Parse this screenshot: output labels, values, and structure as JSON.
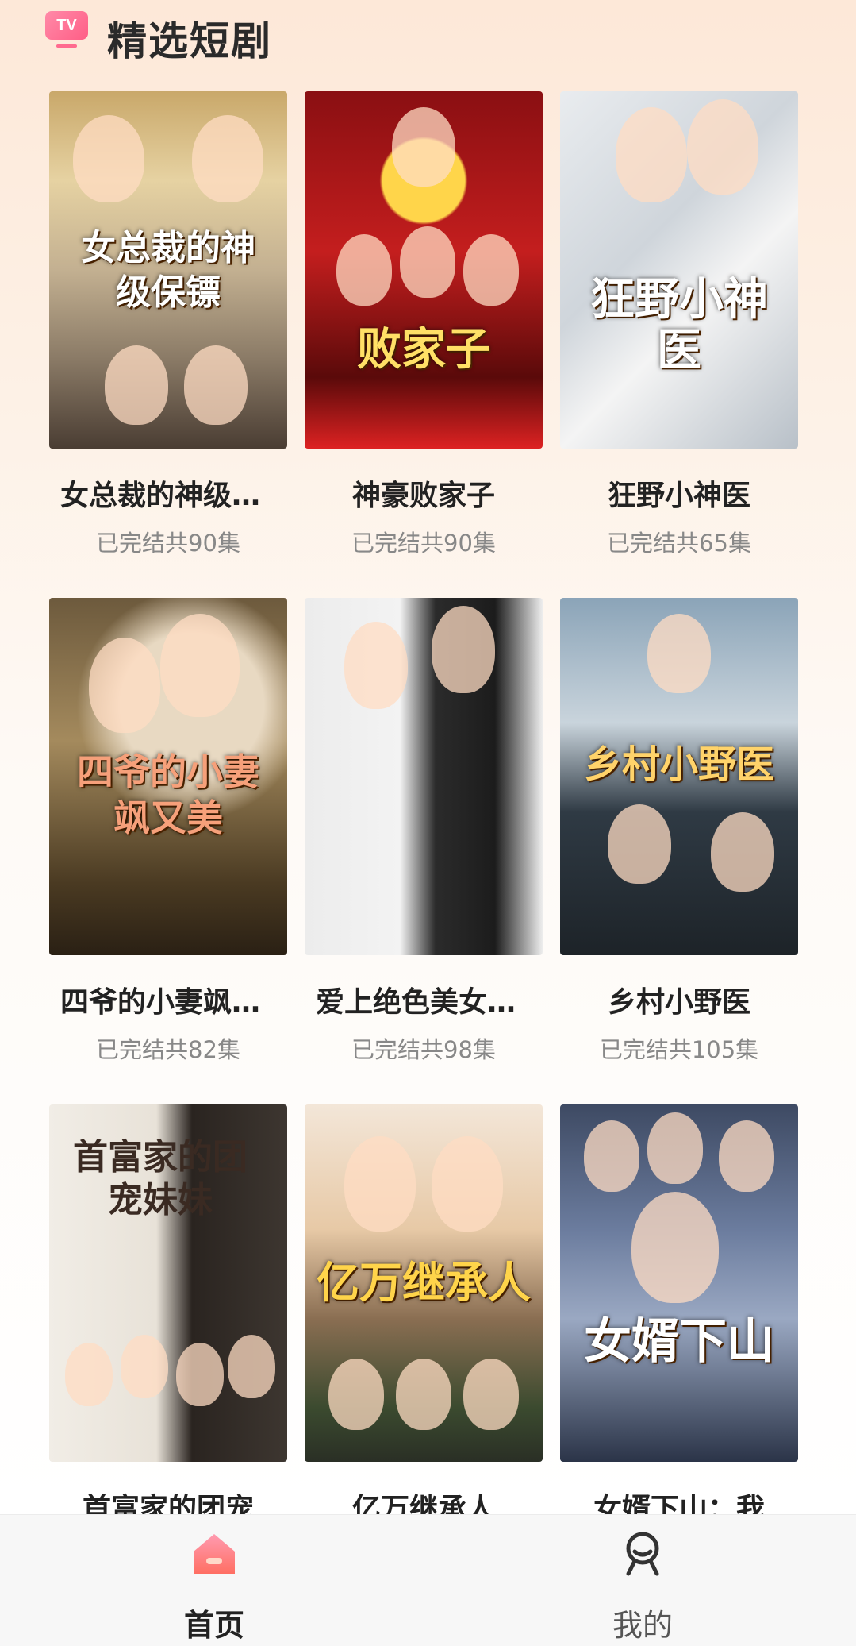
{
  "header": {
    "logo_text": "TV",
    "title": "精选短剧"
  },
  "dramas": [
    {
      "title": "女总裁的神级保镖",
      "status": "已完结共90集",
      "poster_text": "女总裁的神级保镖"
    },
    {
      "title": "神豪败家子",
      "status": "已完结共90集",
      "poster_text": "败家子"
    },
    {
      "title": "狂野小神医",
      "status": "已完结共65集",
      "poster_text": "狂野小神医"
    },
    {
      "title": "四爷的小妻飒又美",
      "status": "已完结共82集",
      "poster_text": "四爷的小妻飒又美"
    },
    {
      "title": "爱上绝色美女总裁",
      "status": "已完结共98集",
      "poster_text": ""
    },
    {
      "title": "乡村小野医",
      "status": "已完结共105集",
      "poster_text": "乡村小野医"
    },
    {
      "title": "首富家的团宠",
      "status": "",
      "poster_text": "首富家的团宠妹妹"
    },
    {
      "title": "亿万继承人",
      "status": "",
      "poster_text": "亿万继承人"
    },
    {
      "title": "女婿下山：我",
      "status": "",
      "poster_text": "女婿下山"
    }
  ],
  "tabbar": {
    "home_label": "首页",
    "mine_label": "我的"
  },
  "colors": {
    "accent": "#ff5e86",
    "title_text": "#222222",
    "subtitle_text": "#888888"
  },
  "icons": {
    "home": "home-icon",
    "mine": "person-icon"
  }
}
